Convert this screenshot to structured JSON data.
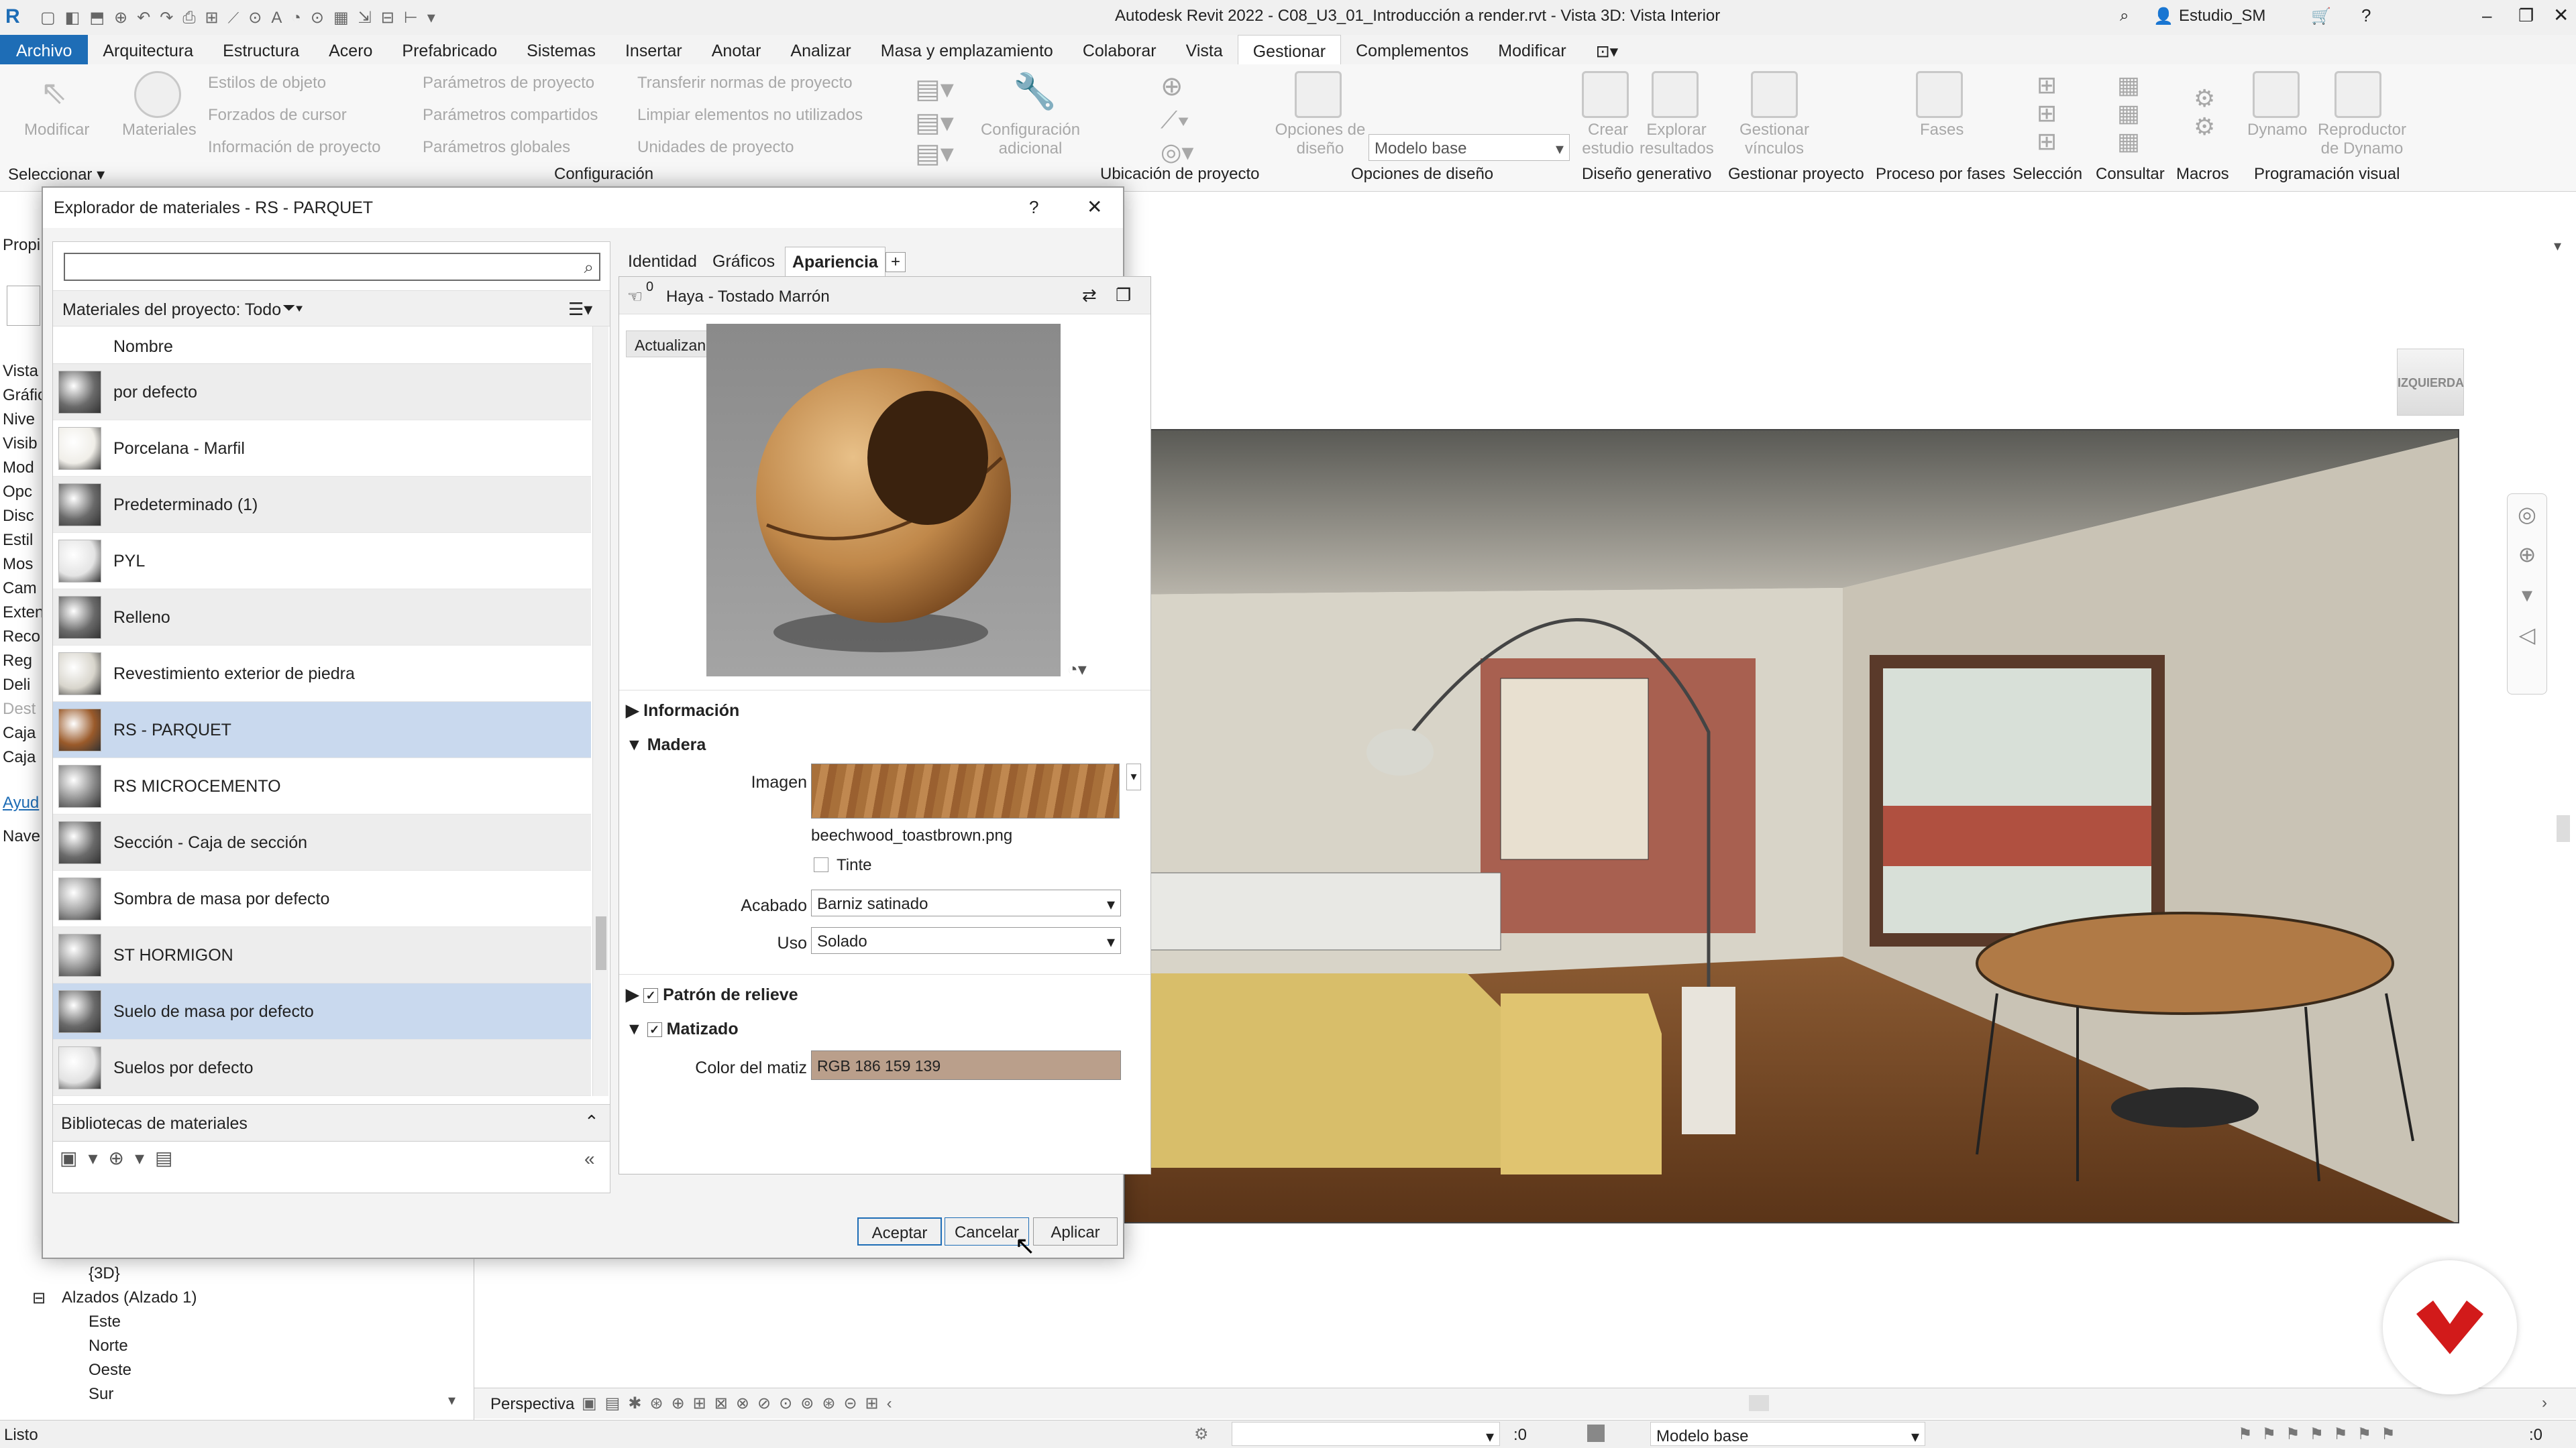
{
  "titlebar": {
    "title": "Autodesk Revit 2022 - C08_U3_01_Introducción a render.rvt - Vista 3D: Vista Interior",
    "user": "Estudio_SM"
  },
  "menu": [
    "Archivo",
    "Arquitectura",
    "Estructura",
    "Acero",
    "Prefabricado",
    "Sistemas",
    "Insertar",
    "Anotar",
    "Analizar",
    "Masa y emplazamiento",
    "Colaborar",
    "Vista",
    "Gestionar",
    "Complementos",
    "Modificar"
  ],
  "menu_active": "Gestionar",
  "ribbon": {
    "modify": "Modificar",
    "materials": "Materiales",
    "col1": [
      "Estilos de objeto",
      "Forzados de cursor",
      "Información de proyecto"
    ],
    "col2": [
      "Parámetros de proyecto",
      "Parámetros compartidos",
      "Parámetros globales"
    ],
    "col3": [
      "Transferir normas de proyecto",
      "Limpiar elementos no utilizados",
      "Unidades de proyecto"
    ],
    "config_adicional": "Configuración adicional",
    "design_options": "Opciones de diseño",
    "design_model": "Modelo base",
    "create_study": "Crear estudio",
    "explore_results": "Explorar resultados",
    "manage_links": "Gestionar vínculos",
    "phases": "Fases",
    "dynamo": "Dynamo",
    "dynamo_player": "Reproductor de Dynamo",
    "groups": {
      "select": "Seleccionar",
      "config": "Configuración",
      "location": "Ubicación de proyecto",
      "design_opts": "Opciones de diseño",
      "gen_design": "Diseño generativo",
      "manage_project": "Gestionar proyecto",
      "phasing": "Proceso por fases",
      "selection": "Selección",
      "query": "Consultar",
      "macros": "Macros",
      "visual_prog": "Programación visual"
    }
  },
  "left_panel": {
    "props": "Propi",
    "items": [
      "Vista",
      "Gráfic",
      "Nive",
      "Visib",
      "Mod",
      "Opc",
      "Disc",
      "Estil",
      "Mos",
      "Cam",
      "Exten",
      "Reco",
      "Reg",
      "Deli",
      "Dest",
      "Caja",
      "Caja"
    ],
    "help": "Ayud",
    "nav": "Nave",
    "tree": [
      "{3D}",
      "Alzados (Alzado 1)",
      "Este",
      "Norte",
      "Oeste",
      "Sur"
    ]
  },
  "view_label": "IZQUIERDA",
  "dialog": {
    "title": "Explorador de materiales - RS - PARQUET",
    "help": "?",
    "close": "✕",
    "filter": "Materiales del proyecto: Todo",
    "col_name": "Nombre",
    "materials": [
      {
        "name": "por defecto",
        "color": "#6a6a6a"
      },
      {
        "name": "Porcelana - Marfil",
        "color": "#f0eee8"
      },
      {
        "name": "Predeterminado (1)",
        "color": "#6a6a6a"
      },
      {
        "name": "PYL",
        "color": "#e4e4e4"
      },
      {
        "name": "Relleno",
        "color": "#6a6a6a"
      },
      {
        "name": "Revestimiento exterior de piedra",
        "color": "#d8d5cc"
      },
      {
        "name": "RS - PARQUET",
        "color": "#9a5a2a"
      },
      {
        "name": "RS MICROCEMENTO",
        "color": "#8a8a8a"
      },
      {
        "name": "Sección - Caja de sección",
        "color": "#6a6a6a"
      },
      {
        "name": "Sombra de masa por defecto",
        "color": "#9a9a9a"
      },
      {
        "name": "ST HORMIGON",
        "color": "#8d8d8d"
      },
      {
        "name": "Suelo de masa por defecto",
        "color": "#6a6a6a"
      },
      {
        "name": "Suelos por defecto",
        "color": "#e2e2e2"
      }
    ],
    "selected": "RS - PARQUET",
    "libraries": "Bibliotecas de materiales",
    "tabs": [
      "Identidad",
      "Gráficos",
      "Apariencia"
    ],
    "active_tab": "Apariencia",
    "asset_count": "0",
    "asset_name": "Haya - Tostado Marrón",
    "updating": "Actualizando...",
    "sections": {
      "info": "Información",
      "wood": "Madera",
      "relief": "Patrón de relieve",
      "tint": "Matizado"
    },
    "image_label": "Imagen",
    "image_file": "beechwood_toastbrown.png",
    "tint_check": "Tinte",
    "finish_label": "Acabado",
    "finish_value": "Barniz satinado",
    "use_label": "Uso",
    "use_value": "Solado",
    "tint_color_label": "Color del matiz",
    "tint_color_value": "RGB 186 159 139",
    "tint_color_hex": "#ba9f8b",
    "ok": "Aceptar",
    "cancel": "Cancelar",
    "apply": "Aplicar"
  },
  "viewbar": {
    "mode": "Perspectiva"
  },
  "status": {
    "text": "Listo",
    "zero": ":0",
    "model": "Modelo base",
    "filter": ":0"
  }
}
